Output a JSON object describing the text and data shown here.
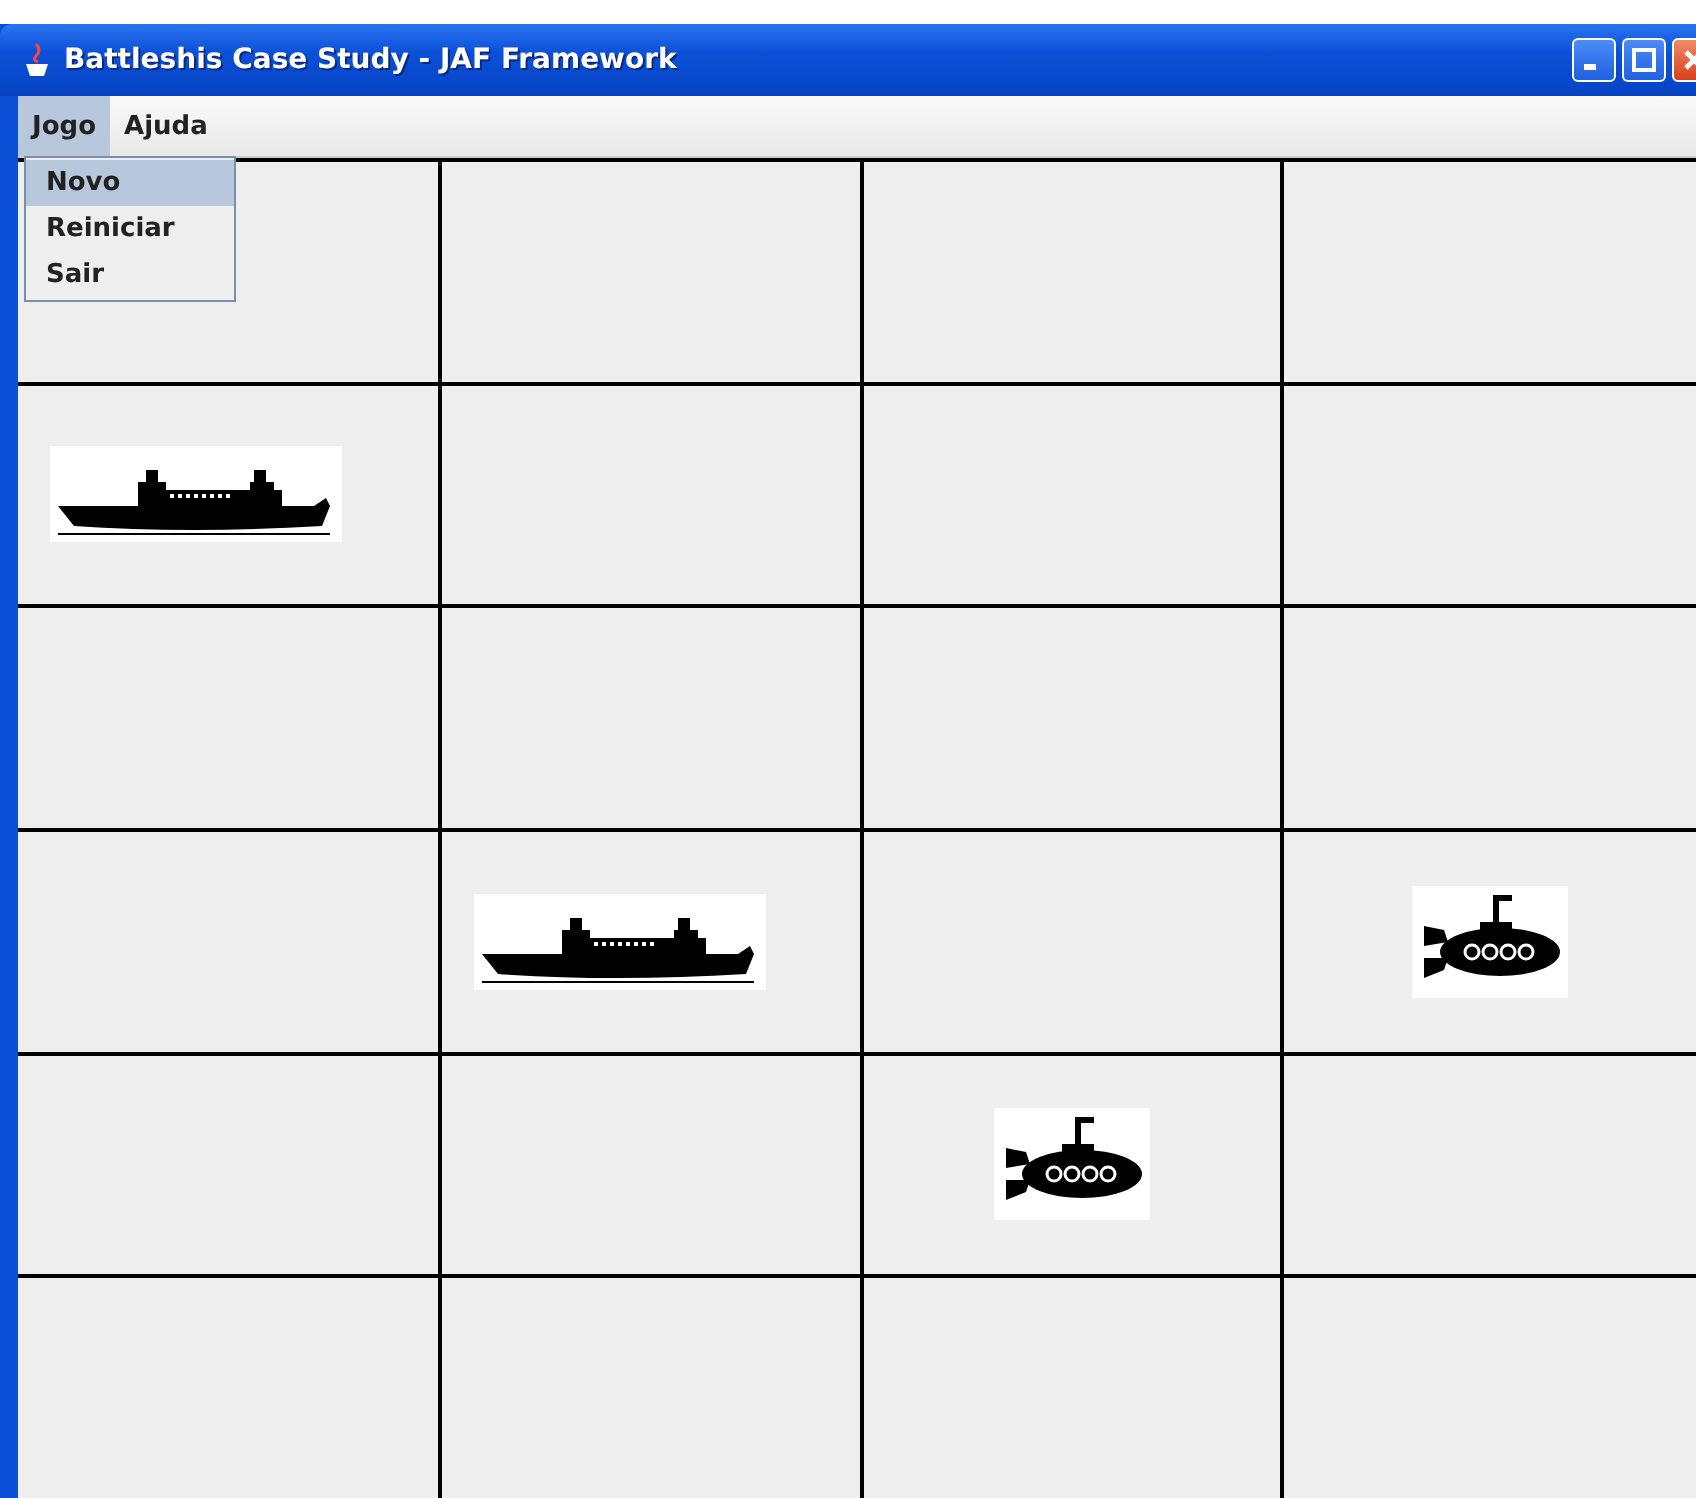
{
  "window": {
    "title": "Battleshis Case Study - JAF Framework"
  },
  "menu_bar": [
    {
      "label": "Jogo",
      "selected": true
    },
    {
      "label": "Ajuda",
      "selected": false
    }
  ],
  "open_menu": {
    "items": [
      {
        "label": "Novo",
        "selected": true
      },
      {
        "label": "Reiniciar",
        "selected": false
      },
      {
        "label": "Sair",
        "selected": false
      }
    ]
  },
  "board": {
    "rows": [
      {
        "cells": [
          {
            "kind": "empty"
          },
          {
            "kind": "empty"
          },
          {
            "kind": "empty"
          },
          {
            "kind": "empty"
          }
        ]
      },
      {
        "cells": [
          {
            "kind": "ship"
          },
          {
            "kind": "empty"
          },
          {
            "kind": "empty"
          },
          {
            "kind": "empty"
          }
        ]
      },
      {
        "cells": [
          {
            "kind": "empty"
          },
          {
            "kind": "empty"
          },
          {
            "kind": "empty"
          },
          {
            "kind": "empty"
          }
        ]
      },
      {
        "cells": [
          {
            "kind": "empty"
          },
          {
            "kind": "ship"
          },
          {
            "kind": "empty"
          },
          {
            "kind": "submarine"
          }
        ]
      },
      {
        "cells": [
          {
            "kind": "empty"
          },
          {
            "kind": "empty"
          },
          {
            "kind": "submarine"
          },
          {
            "kind": "empty"
          }
        ]
      },
      {
        "cells": [
          {
            "kind": "empty"
          },
          {
            "kind": "empty"
          },
          {
            "kind": "empty"
          },
          {
            "kind": "empty"
          }
        ]
      }
    ]
  }
}
